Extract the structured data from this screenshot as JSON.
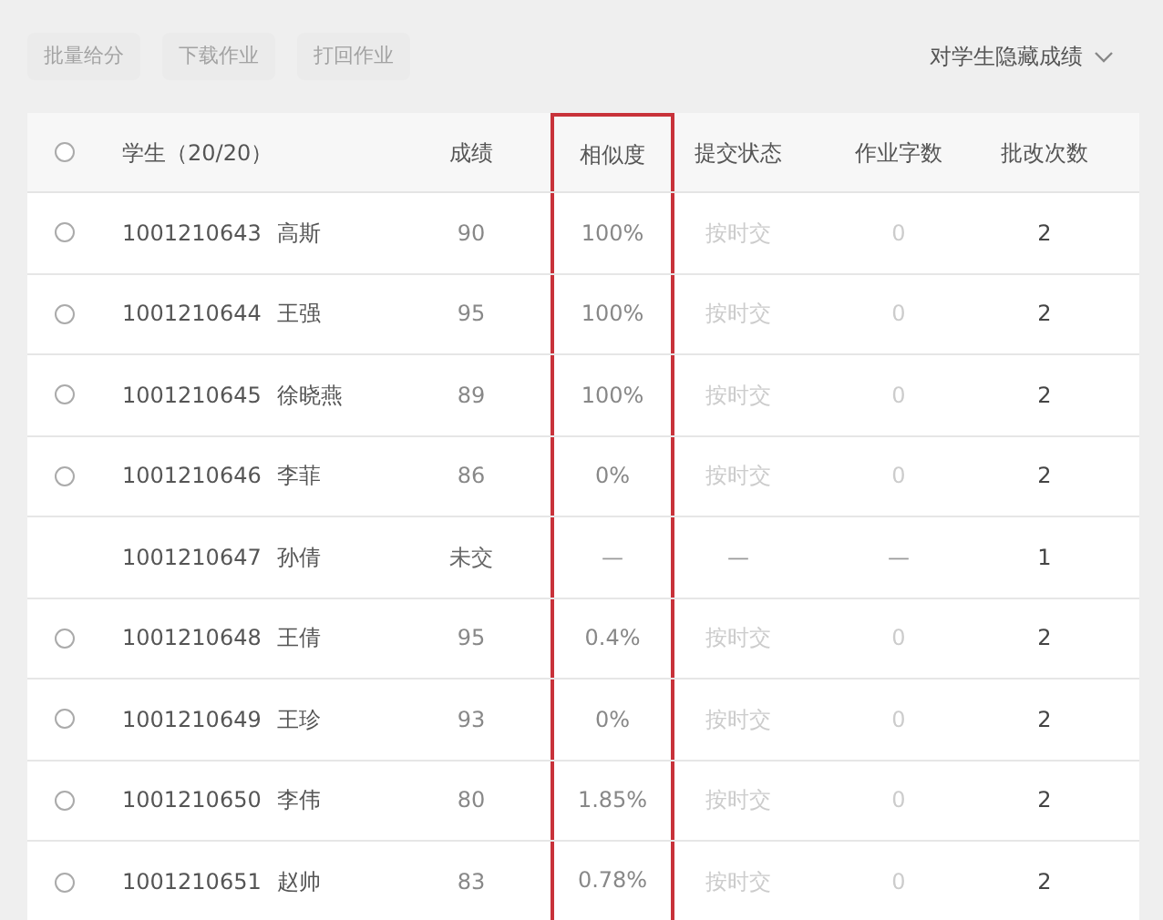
{
  "toolbar": {
    "buttons": [
      {
        "label": "批量给分",
        "disabled": true
      },
      {
        "label": "下载作业",
        "disabled": true
      },
      {
        "label": "打回作业",
        "disabled": true
      }
    ],
    "dropdown": {
      "label": "对学生隐藏成绩"
    }
  },
  "table": {
    "all_selected": false,
    "columns": [
      {
        "kind": "radio",
        "highlighted": false
      },
      {
        "label": "学生（20/20）",
        "kind": "student",
        "highlighted": false
      },
      {
        "label": "成绩",
        "kind": "text",
        "highlighted": false
      },
      {
        "label": "相似度",
        "kind": "text",
        "highlighted": true
      },
      {
        "label": "提交状态",
        "kind": "faint",
        "highlighted": false
      },
      {
        "label": "作业字数",
        "kind": "faint",
        "highlighted": false
      },
      {
        "label": "批改次数",
        "kind": "dark",
        "highlighted": false
      }
    ],
    "rows": [
      {
        "selectable": true,
        "selected": false,
        "id": "1001210643",
        "name": "高斯",
        "score": "90",
        "similarity": "100%",
        "status": "按时交",
        "words": "0",
        "revisions": "2"
      },
      {
        "selectable": true,
        "selected": false,
        "id": "1001210644",
        "name": "王强",
        "score": "95",
        "similarity": "100%",
        "status": "按时交",
        "words": "0",
        "revisions": "2"
      },
      {
        "selectable": true,
        "selected": false,
        "id": "1001210645",
        "name": "徐晓燕",
        "score": "89",
        "similarity": "100%",
        "status": "按时交",
        "words": "0",
        "revisions": "2"
      },
      {
        "selectable": true,
        "selected": false,
        "id": "1001210646",
        "name": "李菲",
        "score": "86",
        "similarity": "0%",
        "status": "按时交",
        "words": "0",
        "revisions": "2"
      },
      {
        "selectable": false,
        "selected": false,
        "id": "1001210647",
        "name": "孙倩",
        "score": "未交",
        "similarity": "—",
        "status": "—",
        "words": "—",
        "revisions": "1"
      },
      {
        "selectable": true,
        "selected": false,
        "id": "1001210648",
        "name": "王倩",
        "score": "95",
        "similarity": "0.4%",
        "status": "按时交",
        "words": "0",
        "revisions": "2"
      },
      {
        "selectable": true,
        "selected": false,
        "id": "1001210649",
        "name": "王珍",
        "score": "93",
        "similarity": "0%",
        "status": "按时交",
        "words": "0",
        "revisions": "2"
      },
      {
        "selectable": true,
        "selected": false,
        "id": "1001210650",
        "name": "李伟",
        "score": "80",
        "similarity": "1.85%",
        "status": "按时交",
        "words": "0",
        "revisions": "2"
      },
      {
        "selectable": true,
        "selected": false,
        "id": "1001210651",
        "name": "赵帅",
        "score": "83",
        "similarity": "0.78%",
        "status": "按时交",
        "words": "0",
        "revisions": "2"
      }
    ]
  }
}
